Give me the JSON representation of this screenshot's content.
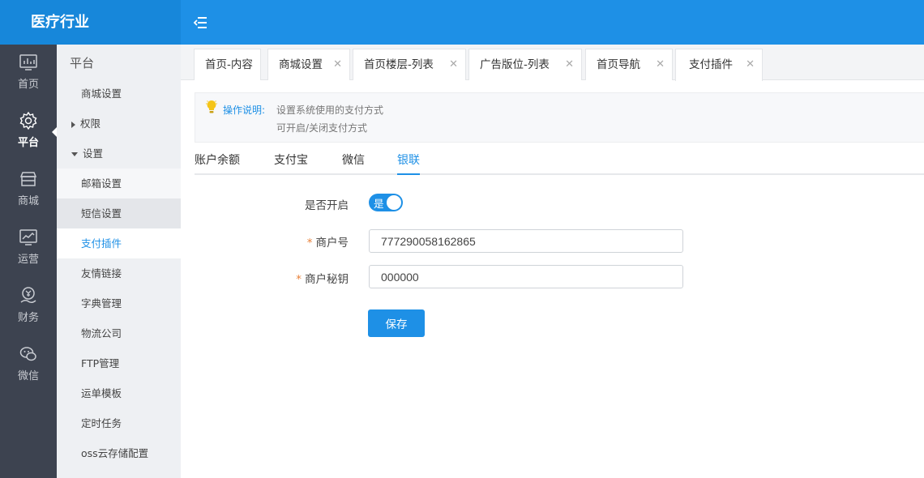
{
  "header": {
    "brand": "医疗行业"
  },
  "rail": {
    "items": [
      {
        "label": "首页",
        "icon": "dashboard-icon"
      },
      {
        "label": "平台",
        "icon": "gear-icon"
      },
      {
        "label": "商城",
        "icon": "store-icon"
      },
      {
        "label": "运营",
        "icon": "monitor-chart-icon"
      },
      {
        "label": "财务",
        "icon": "finance-icon"
      },
      {
        "label": "微信",
        "icon": "wechat-icon"
      }
    ],
    "active": "平台"
  },
  "submenu": {
    "title": "平台",
    "items": [
      "商城设置",
      "权限",
      "设置",
      "邮箱设置",
      "短信设置",
      "支付插件",
      "友情链接",
      "字典管理",
      "物流公司",
      "FTP管理",
      "运单模板",
      "定时任务",
      "oss云存储配置"
    ],
    "active": "支付插件"
  },
  "tabs": [
    {
      "label": "首页-内容"
    },
    {
      "label": "商城设置"
    },
    {
      "label": "首页楼层-列表"
    },
    {
      "label": "广告版位-列表"
    },
    {
      "label": "首页导航"
    },
    {
      "label": "支付插件"
    }
  ],
  "tip": {
    "label": "操作说明:",
    "line1": "设置系统使用的支付方式",
    "line2": "可开启/关闭支付方式"
  },
  "payment_tabs": [
    {
      "label": "账户余额"
    },
    {
      "label": "支付宝"
    },
    {
      "label": "微信"
    },
    {
      "label": "银联"
    }
  ],
  "payment_active": "银联",
  "form": {
    "enabled_label": "是否开启",
    "enabled_value": "是",
    "merchant_id_label": "商户号",
    "merchant_id_value": "777290058162865",
    "merchant_key_label": "商户秘钥",
    "merchant_key_value": "000000",
    "required_mark": "*",
    "save_label": "保存"
  },
  "colors": {
    "accent": "#1E90E6",
    "rail_bg": "#3D4350",
    "submenu_bg": "#EEF0F3",
    "required": "#E8813A"
  }
}
